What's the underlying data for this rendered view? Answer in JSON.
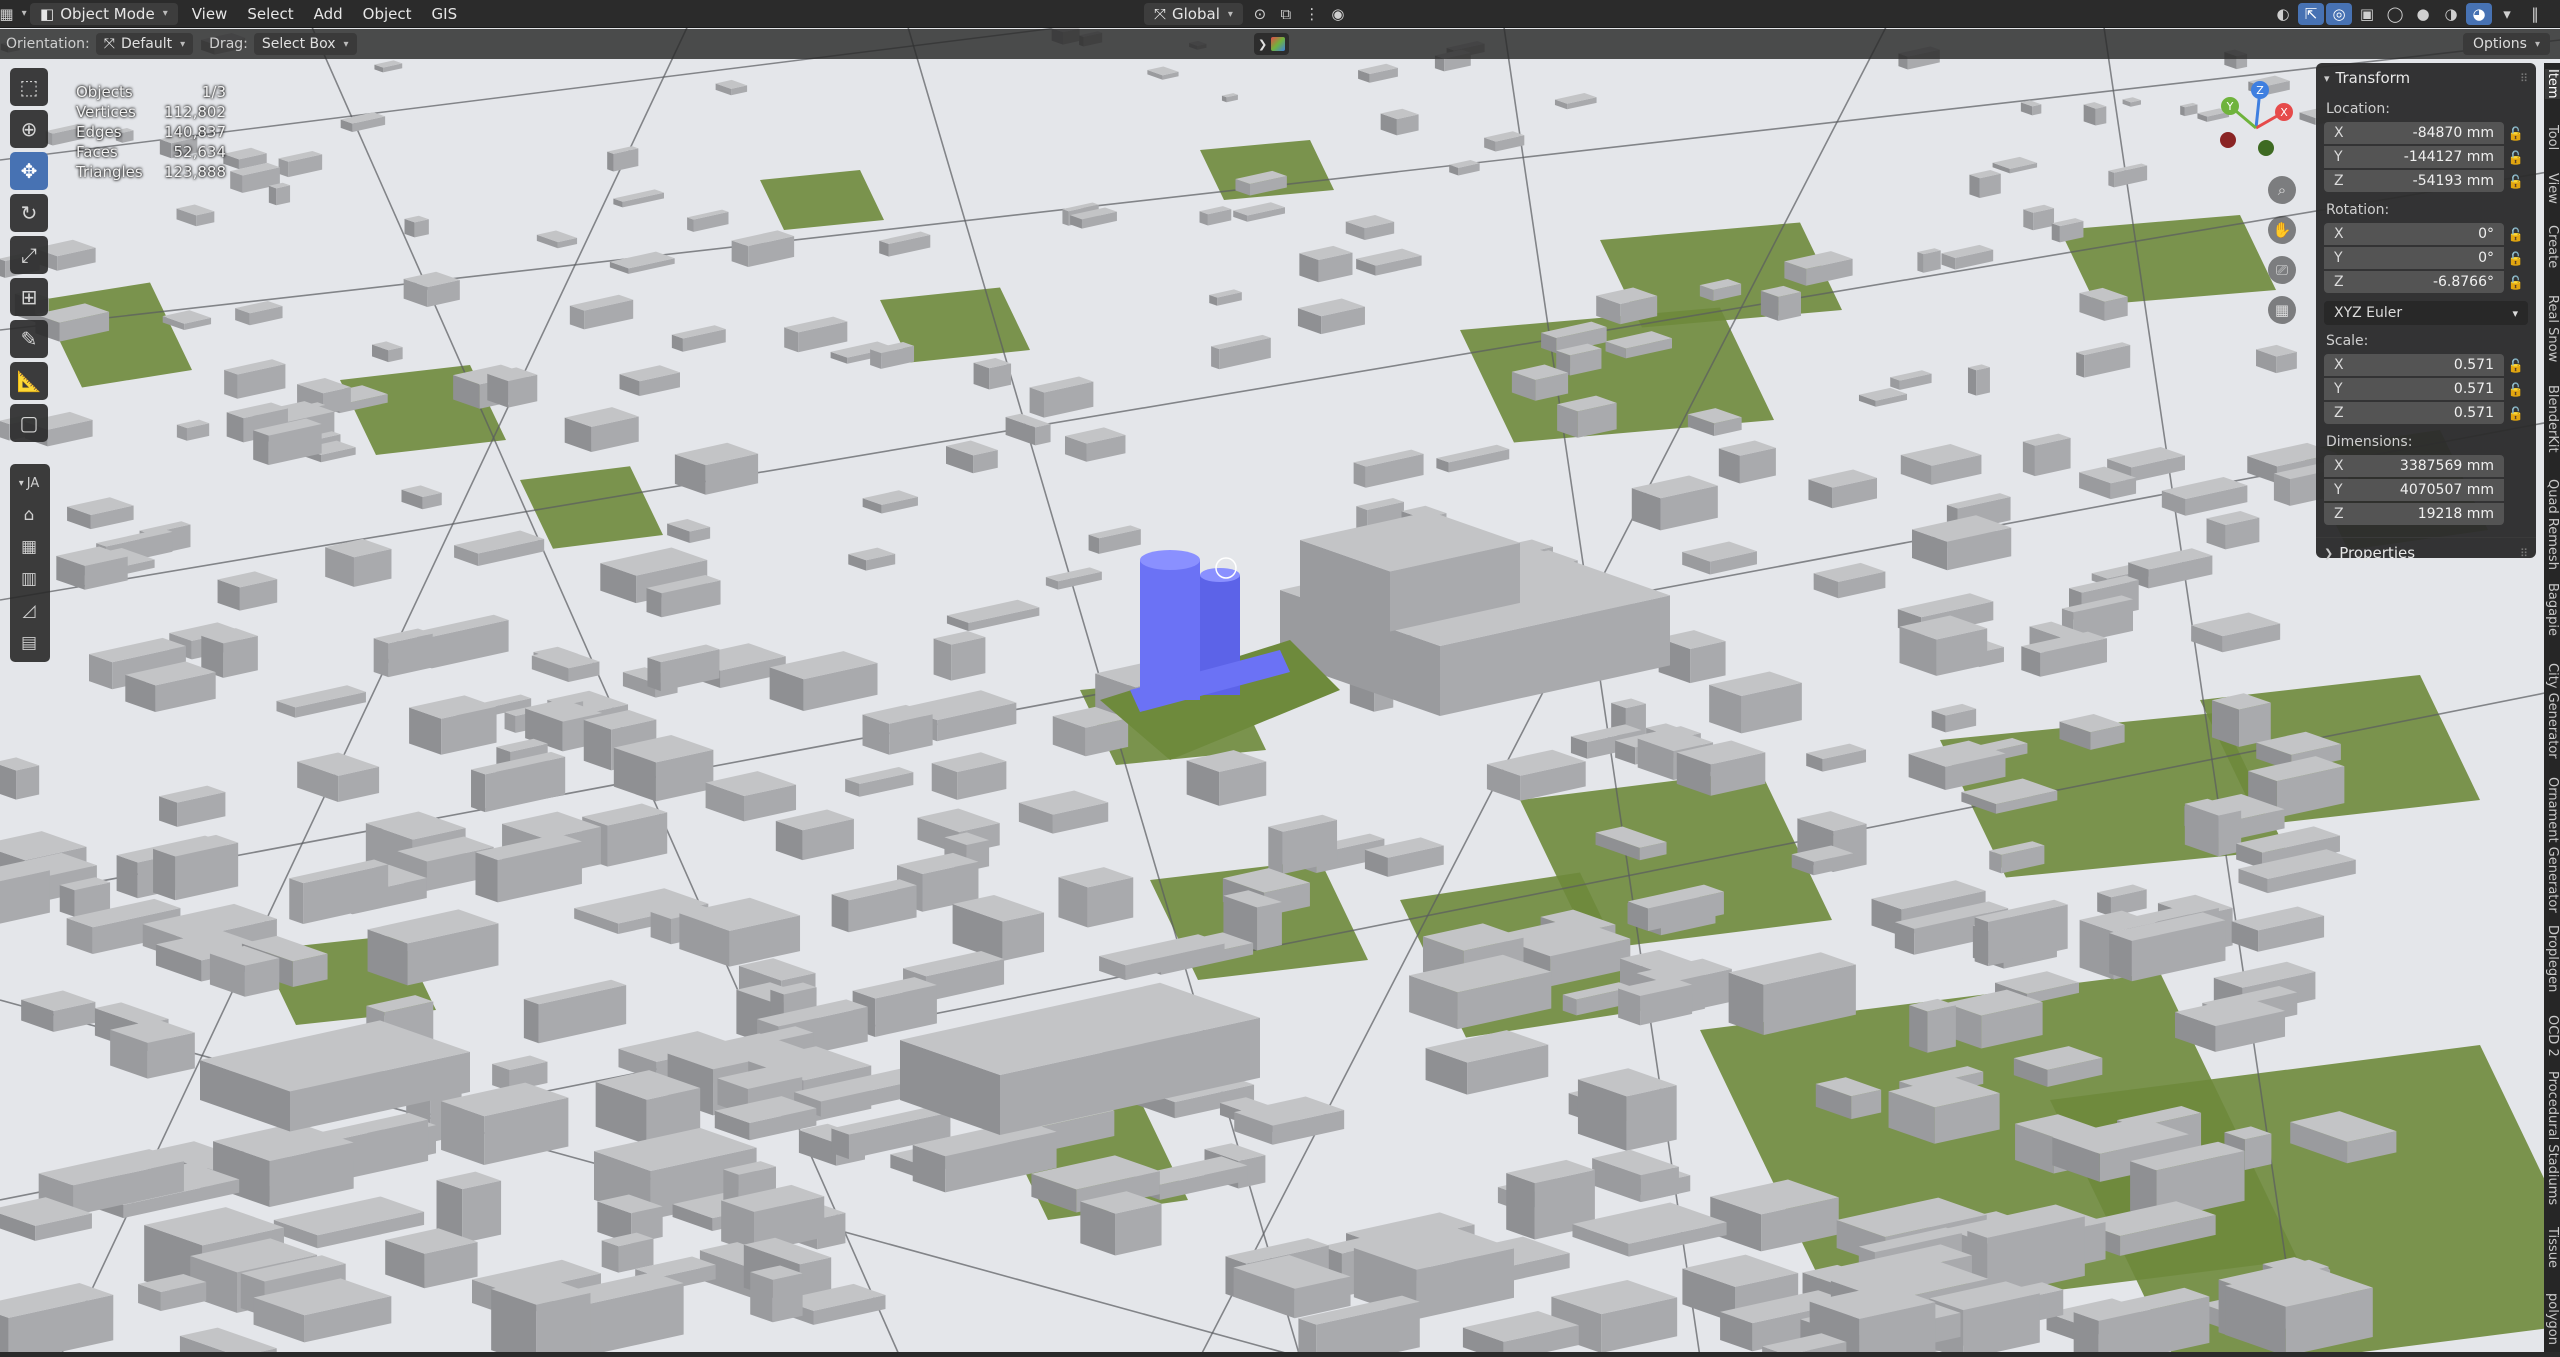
{
  "header": {
    "editor_type_icon": "view3d-icon",
    "mode_label": "Object Mode",
    "menus": [
      "View",
      "Select",
      "Add",
      "Object",
      "GIS"
    ],
    "transform_orientation": "Global"
  },
  "tool_settings": {
    "orientation_label": "Orientation:",
    "orientation_value": "Default",
    "drag_label": "Drag:",
    "drag_value": "Select Box",
    "options_label": "Options"
  },
  "stats": {
    "rows": [
      {
        "label": "Objects",
        "value": "1/3"
      },
      {
        "label": "Vertices",
        "value": "112,802"
      },
      {
        "label": "Edges",
        "value": "140,837"
      },
      {
        "label": "Faces",
        "value": "52,634"
      },
      {
        "label": "Triangles",
        "value": "123,888"
      }
    ]
  },
  "left_toolbar": {
    "tools": [
      "select-box-icon",
      "cursor-icon",
      "move-icon",
      "rotate-icon",
      "scale-icon",
      "transform-icon",
      "annotate-icon",
      "measure-icon",
      "add-cube-icon"
    ],
    "addon_group_label": "JA",
    "addon_tools": [
      "building-icon",
      "grid-icon",
      "wall-icon",
      "roof-icon",
      "floor-icon"
    ]
  },
  "gizmo": {
    "axes": [
      "X",
      "Y",
      "Z"
    ],
    "colors": {
      "x": "#e64a4a",
      "y": "#6fb33c",
      "z": "#3f7fe0"
    }
  },
  "npanel": {
    "transform_title": "Transform",
    "location_label": "Location:",
    "location": [
      {
        "axis": "X",
        "value": "-84870 mm"
      },
      {
        "axis": "Y",
        "value": "-144127 mm"
      },
      {
        "axis": "Z",
        "value": "-54193 mm"
      }
    ],
    "rotation_label": "Rotation:",
    "rotation": [
      {
        "axis": "X",
        "value": "0°"
      },
      {
        "axis": "Y",
        "value": "0°"
      },
      {
        "axis": "Z",
        "value": "-6.8766°"
      }
    ],
    "rotation_mode": "XYZ Euler",
    "scale_label": "Scale:",
    "scale": [
      {
        "axis": "X",
        "value": "0.571"
      },
      {
        "axis": "Y",
        "value": "0.571"
      },
      {
        "axis": "Z",
        "value": "0.571"
      }
    ],
    "dimensions_label": "Dimensions:",
    "dimensions": [
      {
        "axis": "X",
        "value": "3387569 mm"
      },
      {
        "axis": "Y",
        "value": "4070507 mm"
      },
      {
        "axis": "Z",
        "value": "19218 mm"
      }
    ],
    "properties_title": "Properties"
  },
  "sidebar_tabs": [
    "Item",
    "Tool",
    "View",
    "Create",
    "Real Snow",
    "BlenderKit",
    "Quad Remesh",
    "Bagapie",
    "City Generator",
    "Ornament Generator",
    "Droplegen",
    "OCD 2",
    "Procedural Stadiums",
    "Tissue",
    "polygon"
  ],
  "colors": {
    "accent": "#4772b3",
    "selected_object": "#6b72f5",
    "grass": "#6e8a3c",
    "ground": "#e4e6ea",
    "building": "#b7b8ba"
  }
}
